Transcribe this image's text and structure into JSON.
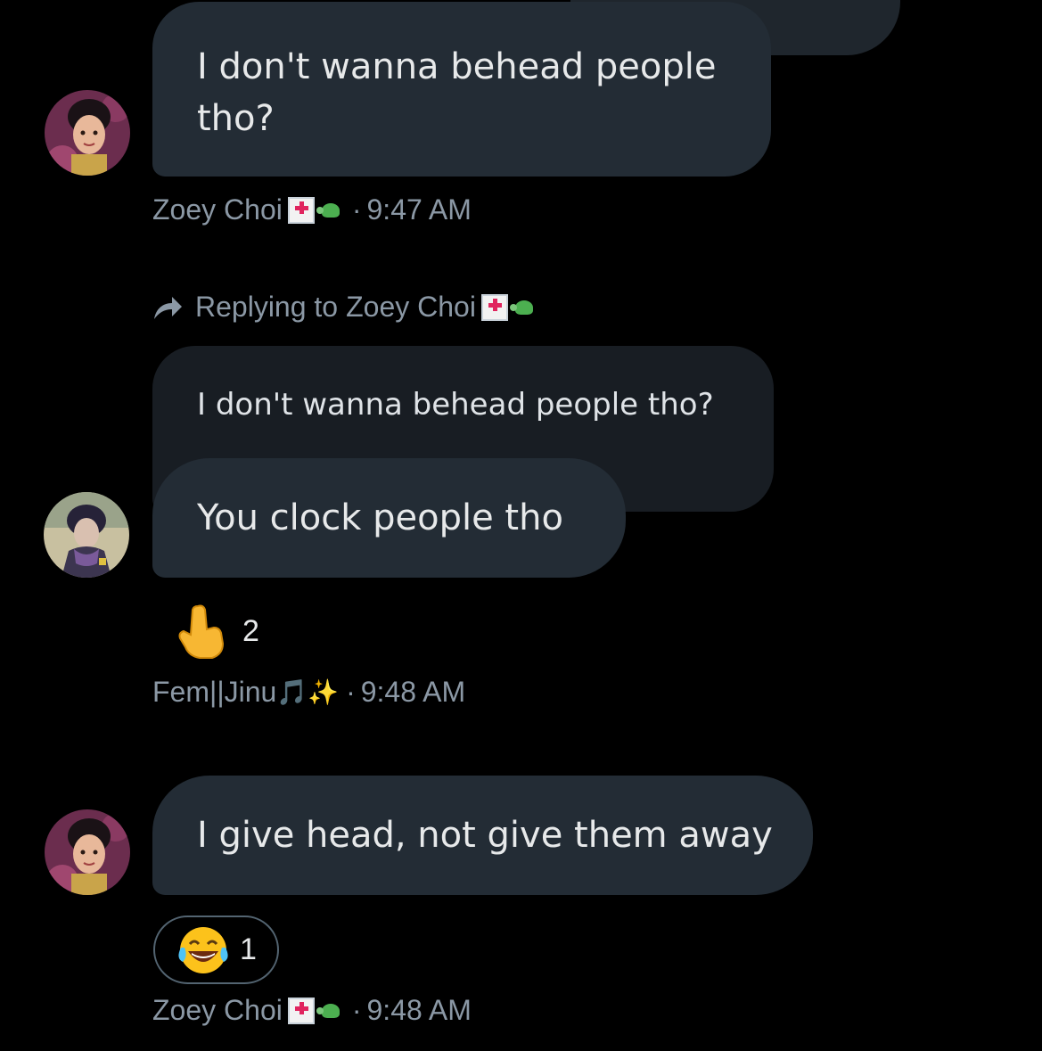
{
  "messages": [
    {
      "text": "I don't wanna behead people tho?",
      "author": "Zoey Choi",
      "time": "9:47 AM"
    },
    {
      "reply_prefix": "Replying to",
      "reply_to": "Zoey Choi",
      "quoted_text": "I don't wanna behead people tho?",
      "text": "You clock people tho",
      "reaction_count": "2",
      "author": "Fem||Jinu",
      "author_emoji": "🎵✨",
      "time": "9:48 AM"
    },
    {
      "text": "I give head, not give them away",
      "reaction_count": "1",
      "author": "Zoey Choi",
      "time": "9:48 AM"
    }
  ],
  "separator": "·",
  "colors": {
    "background": "#000000",
    "bubble": "#232c35",
    "quoted_bubble": "#181d23",
    "meta_text": "#8b98a5"
  }
}
